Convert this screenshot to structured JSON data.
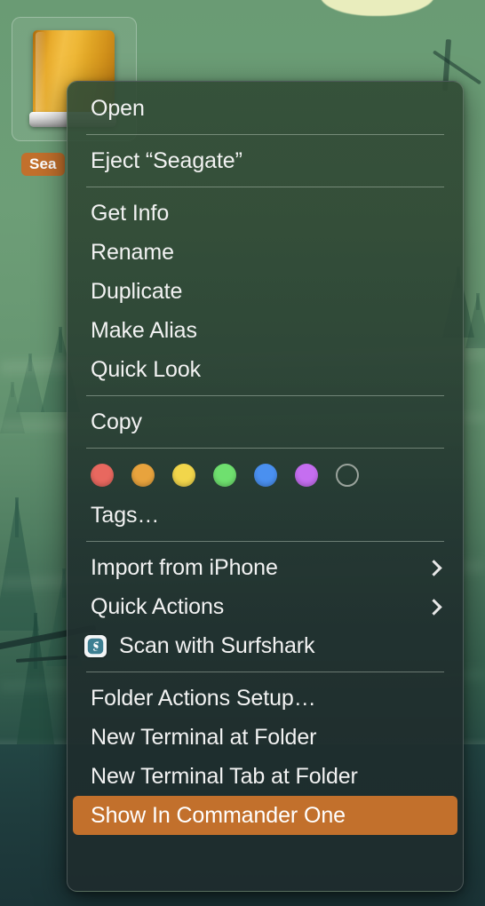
{
  "desktop": {
    "wallpaper_description": "green forest pines with mist over dark teal water",
    "colors": {
      "wallpaper_top": "#6a9b74",
      "wallpaper_bottom": "#1e3a3b",
      "sky_patch": "#e9edbd",
      "accent_orange": "#c2702c",
      "menu_text": "#f2f2f2",
      "separator": "rgba(208,222,208,0.42)"
    }
  },
  "drive": {
    "name": "Seagate",
    "label_visible": "Sea",
    "icon_name": "external-hard-drive-icon",
    "icon_colors": {
      "body": "#eeb736",
      "base": "#dcdcdc"
    }
  },
  "menu": {
    "title": "Finder context menu",
    "sections": [
      {
        "items": [
          {
            "id": "open",
            "label": "Open",
            "type": "item"
          }
        ]
      },
      {
        "items": [
          {
            "id": "eject",
            "label": "Eject “Seagate”",
            "type": "item"
          }
        ]
      },
      {
        "items": [
          {
            "id": "get-info",
            "label": "Get Info",
            "type": "item"
          },
          {
            "id": "rename",
            "label": "Rename",
            "type": "item"
          },
          {
            "id": "duplicate",
            "label": "Duplicate",
            "type": "item"
          },
          {
            "id": "make-alias",
            "label": "Make Alias",
            "type": "item"
          },
          {
            "id": "quick-look",
            "label": "Quick Look",
            "type": "item"
          }
        ]
      },
      {
        "items": [
          {
            "id": "copy",
            "label": "Copy",
            "type": "item"
          }
        ]
      },
      {
        "items": [
          {
            "id": "tags-row",
            "type": "tag-swatches"
          },
          {
            "id": "tags",
            "label": "Tags…",
            "type": "item"
          }
        ]
      },
      {
        "items": [
          {
            "id": "import-from-iphone",
            "label": "Import from iPhone",
            "type": "submenu"
          },
          {
            "id": "quick-actions",
            "label": "Quick Actions",
            "type": "submenu"
          },
          {
            "id": "scan-with-surfshark",
            "label": "Scan with Surfshark",
            "type": "item-with-icon",
            "icon": "surfshark-icon"
          }
        ]
      },
      {
        "items": [
          {
            "id": "folder-actions-setup",
            "label": "Folder Actions Setup…",
            "type": "item"
          },
          {
            "id": "new-terminal-at-folder",
            "label": "New Terminal at Folder",
            "type": "item"
          },
          {
            "id": "new-terminal-tab-at-folder",
            "label": "New Terminal Tab at Folder",
            "type": "item"
          },
          {
            "id": "show-in-commander-one",
            "label": "Show In Commander One",
            "type": "item",
            "highlighted": true
          }
        ]
      }
    ],
    "tags": [
      {
        "name": "red",
        "color": "#e8685f"
      },
      {
        "name": "orange",
        "color": "#e8a33d"
      },
      {
        "name": "yellow",
        "color": "#f2d64b"
      },
      {
        "name": "green",
        "color": "#6fe06f"
      },
      {
        "name": "blue",
        "color": "#4a90f0"
      },
      {
        "name": "purple",
        "color": "#c56ef0"
      },
      {
        "name": "none",
        "color": ""
      }
    ],
    "highlight_color": "#c2702c"
  }
}
